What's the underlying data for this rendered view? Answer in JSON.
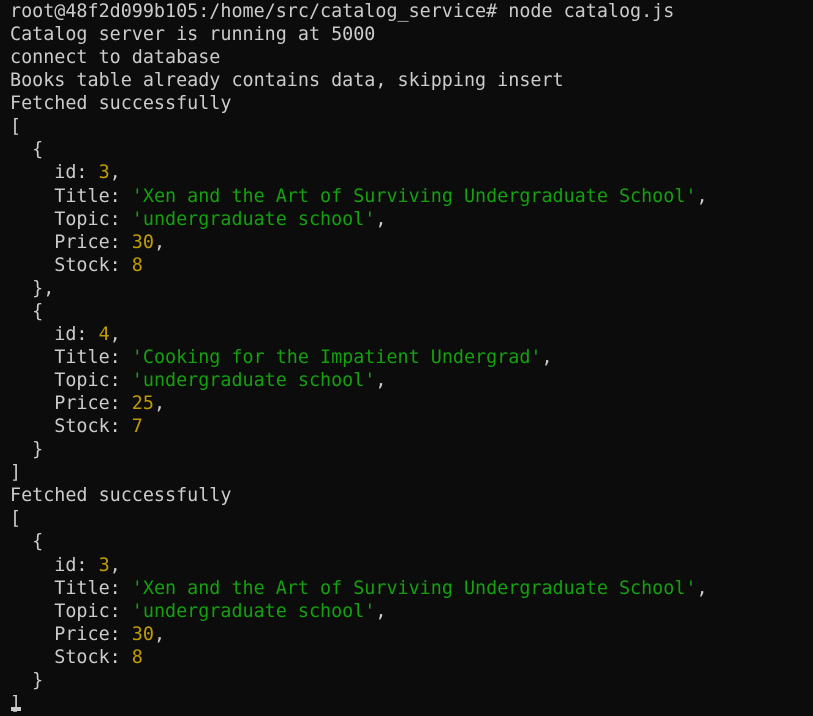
{
  "colors": {
    "background": "#0c0c0c",
    "plain": "#cccccc",
    "number": "#c19c00",
    "string": "#13a10e"
  },
  "lines": [
    [
      {
        "t": "root@48f2d099b105:/home/src/catalog_service# node catalog.js",
        "c": "plain"
      }
    ],
    [
      {
        "t": "Catalog server is running at 5000",
        "c": "plain"
      }
    ],
    [
      {
        "t": "connect to database",
        "c": "plain"
      }
    ],
    [
      {
        "t": "Books table already contains data, skipping insert",
        "c": "plain"
      }
    ],
    [
      {
        "t": "Fetched successfully",
        "c": "plain"
      }
    ],
    [
      {
        "t": "[",
        "c": "plain"
      }
    ],
    [
      {
        "t": "  {",
        "c": "plain"
      }
    ],
    [
      {
        "t": "    id: ",
        "c": "plain"
      },
      {
        "t": "3",
        "c": "num"
      },
      {
        "t": ",",
        "c": "plain"
      }
    ],
    [
      {
        "t": "    Title: ",
        "c": "plain"
      },
      {
        "t": "'Xen and the Art of Surviving Undergraduate School'",
        "c": "str"
      },
      {
        "t": ",",
        "c": "plain"
      }
    ],
    [
      {
        "t": "    Topic: ",
        "c": "plain"
      },
      {
        "t": "'undergraduate school'",
        "c": "str"
      },
      {
        "t": ",",
        "c": "plain"
      }
    ],
    [
      {
        "t": "    Price: ",
        "c": "plain"
      },
      {
        "t": "30",
        "c": "num"
      },
      {
        "t": ",",
        "c": "plain"
      }
    ],
    [
      {
        "t": "    Stock: ",
        "c": "plain"
      },
      {
        "t": "8",
        "c": "num"
      }
    ],
    [
      {
        "t": "  },",
        "c": "plain"
      }
    ],
    [
      {
        "t": "  {",
        "c": "plain"
      }
    ],
    [
      {
        "t": "    id: ",
        "c": "plain"
      },
      {
        "t": "4",
        "c": "num"
      },
      {
        "t": ",",
        "c": "plain"
      }
    ],
    [
      {
        "t": "    Title: ",
        "c": "plain"
      },
      {
        "t": "'Cooking for the Impatient Undergrad'",
        "c": "str"
      },
      {
        "t": ",",
        "c": "plain"
      }
    ],
    [
      {
        "t": "    Topic: ",
        "c": "plain"
      },
      {
        "t": "'undergraduate school'",
        "c": "str"
      },
      {
        "t": ",",
        "c": "plain"
      }
    ],
    [
      {
        "t": "    Price: ",
        "c": "plain"
      },
      {
        "t": "25",
        "c": "num"
      },
      {
        "t": ",",
        "c": "plain"
      }
    ],
    [
      {
        "t": "    Stock: ",
        "c": "plain"
      },
      {
        "t": "7",
        "c": "num"
      }
    ],
    [
      {
        "t": "  }",
        "c": "plain"
      }
    ],
    [
      {
        "t": "]",
        "c": "plain"
      }
    ],
    [
      {
        "t": "Fetched successfully",
        "c": "plain"
      }
    ],
    [
      {
        "t": "[",
        "c": "plain"
      }
    ],
    [
      {
        "t": "  {",
        "c": "plain"
      }
    ],
    [
      {
        "t": "    id: ",
        "c": "plain"
      },
      {
        "t": "3",
        "c": "num"
      },
      {
        "t": ",",
        "c": "plain"
      }
    ],
    [
      {
        "t": "    Title: ",
        "c": "plain"
      },
      {
        "t": "'Xen and the Art of Surviving Undergraduate School'",
        "c": "str"
      },
      {
        "t": ",",
        "c": "plain"
      }
    ],
    [
      {
        "t": "    Topic: ",
        "c": "plain"
      },
      {
        "t": "'undergraduate school'",
        "c": "str"
      },
      {
        "t": ",",
        "c": "plain"
      }
    ],
    [
      {
        "t": "    Price: ",
        "c": "plain"
      },
      {
        "t": "30",
        "c": "num"
      },
      {
        "t": ",",
        "c": "plain"
      }
    ],
    [
      {
        "t": "    Stock: ",
        "c": "plain"
      },
      {
        "t": "8",
        "c": "num"
      }
    ],
    [
      {
        "t": "  }",
        "c": "plain"
      }
    ],
    [
      {
        "t": "]",
        "c": "plain"
      }
    ]
  ]
}
